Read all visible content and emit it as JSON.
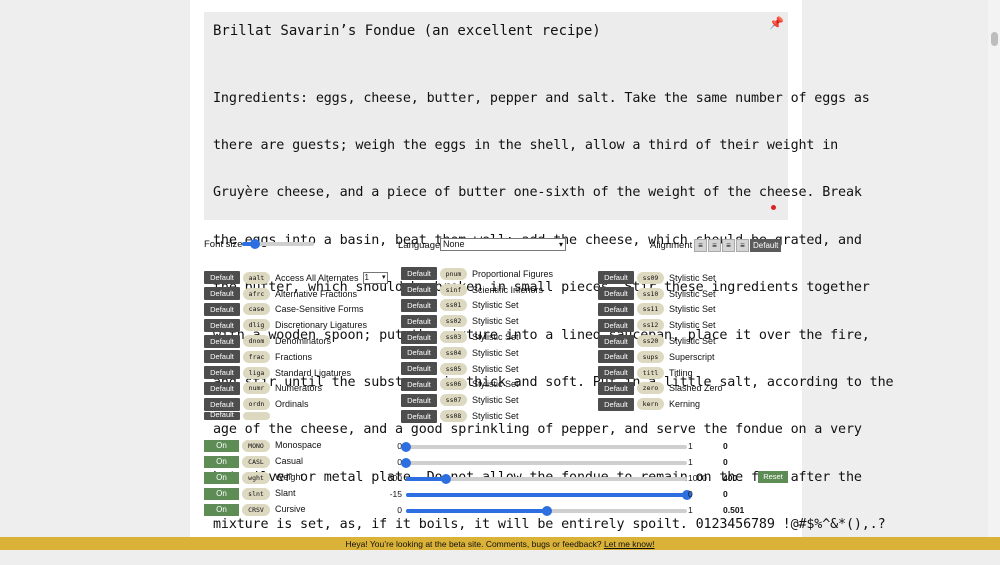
{
  "sample": {
    "title": "Brillat Savarin’s Fondue (an excellent recipe)",
    "lines": [
      "Ingredients: eggs, cheese, butter, pepper and salt. Take the same number of eggs as",
      "there are guests; weigh the eggs in the shell, allow a third of their weight in",
      "Gruyère cheese, and a piece of butter one-sixth of the weight of the cheese. Break",
      "the eggs into a basin, beat them well; add the cheese, which should be grated, and",
      "the butter, which should be broken in small pieces. Stir these ingredients together",
      "with a wooden spoon; put the mixture into a lined saucepan, place it over the fire,",
      "and stir until the substance is thick and soft. Put in a little salt, according to the",
      "age of the cheese, and a good sprinkling of pepper, and serve the fondue on a very",
      "hot silver or metal plate. Do not allow the fondue to remain on the fire after the",
      "mixture is set, as, if it boils, it will be entirely spoilt. 0123456789 !@#$%^&*(),.?"
    ],
    "pin_icon": "pin-icon"
  },
  "controls": {
    "font_size_label": "Font size",
    "font_size_level": 0.18,
    "language_label": "Language",
    "language_value": "None",
    "alignment_label": "Alignment",
    "alignment_default": "Default"
  },
  "features": {
    "default_label": "Default",
    "col1": [
      {
        "tag": "aalt",
        "name": "Access All Alternates",
        "select": "1"
      },
      {
        "tag": "afrc",
        "name": "Alternative Fractions"
      },
      {
        "tag": "case",
        "name": "Case-Sensitive Forms"
      },
      {
        "tag": "dlig",
        "name": "Discretionary Ligatures"
      },
      {
        "tag": "dnom",
        "name": "Denominators"
      },
      {
        "tag": "frac",
        "name": "Fractions"
      },
      {
        "tag": "liga",
        "name": "Standard Ligatures"
      },
      {
        "tag": "numr",
        "name": "Numerators"
      },
      {
        "tag": "ordn",
        "name": "Ordinals"
      }
    ],
    "col2": [
      {
        "tag": "pnum",
        "name": "Proportional Figures"
      },
      {
        "tag": "sinf",
        "name": "Scientific Inferiors"
      },
      {
        "tag": "ss01",
        "name": "Stylistic Set"
      },
      {
        "tag": "ss02",
        "name": "Stylistic Set"
      },
      {
        "tag": "ss03",
        "name": "Stylistic Set"
      },
      {
        "tag": "ss04",
        "name": "Stylistic Set"
      },
      {
        "tag": "ss05",
        "name": "Stylistic Set"
      },
      {
        "tag": "ss06",
        "name": "Stylistic Set"
      },
      {
        "tag": "ss07",
        "name": "Stylistic Set"
      },
      {
        "tag": "ss08",
        "name": "Stylistic Set"
      }
    ],
    "col3": [
      {
        "tag": "ss09",
        "name": "Stylistic Set"
      },
      {
        "tag": "ss10",
        "name": "Stylistic Set"
      },
      {
        "tag": "ss11",
        "name": "Stylistic Set"
      },
      {
        "tag": "ss12",
        "name": "Stylistic Set"
      },
      {
        "tag": "ss20",
        "name": "Stylistic Set"
      },
      {
        "tag": "sups",
        "name": "Superscript"
      },
      {
        "tag": "titl",
        "name": "Titling"
      },
      {
        "tag": "zero",
        "name": "Slashed Zero"
      },
      {
        "tag": "kern",
        "name": "Kerning"
      }
    ]
  },
  "axes": {
    "on_label": "On",
    "reset_label": "Reset",
    "items": [
      {
        "tag": "MONO",
        "name": "Monospace",
        "min": "0",
        "max": "1",
        "value": "0",
        "level": 0
      },
      {
        "tag": "CASL",
        "name": "Casual",
        "min": "0",
        "max": "1",
        "value": "0",
        "level": 0
      },
      {
        "tag": "wght",
        "name": "Weight",
        "min": "300",
        "max": "1000",
        "value": "400",
        "level": 0.143
      },
      {
        "tag": "slnt",
        "name": "Slant",
        "min": "-15",
        "max": "0",
        "value": "0",
        "level": 1
      },
      {
        "tag": "CRSV",
        "name": "Cursive",
        "min": "0",
        "max": "1",
        "value": "0.501",
        "level": 0.501
      }
    ]
  },
  "banner": {
    "text": "Heya! You’re looking at the beta site. Comments, bugs or feedback?",
    "link": "Let me know!"
  }
}
